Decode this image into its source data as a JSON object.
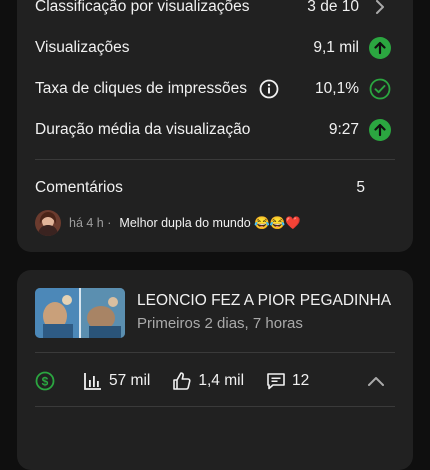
{
  "metrics_card": {
    "ranking": {
      "label": "Classificação por visualizações",
      "value": "3 de 10"
    },
    "views": {
      "label": "Visualizações",
      "value": "9,1 mil"
    },
    "ctr": {
      "label": "Taxa de cliques de impressões",
      "value": "10,1%"
    },
    "avg_duration": {
      "label": "Duração média da visualização",
      "value": "9:27"
    },
    "comments": {
      "label": "Comentários",
      "count": "5"
    },
    "latest_comment": {
      "time": "há 4 h",
      "separator": "·",
      "text": "Melhor dupla do mundo 😂😂❤️"
    }
  },
  "video_card": {
    "title": "LEONCIO FEZ A PIOR PEGADINHA ...",
    "subtitle": "Primeiros 2 dias, 7 horas",
    "stats": {
      "views": "57 mil",
      "likes": "1,4 mil",
      "comments": "12"
    }
  },
  "colors": {
    "background": "#0f0f0f",
    "card": "#212121",
    "positive_green": "#2ba640",
    "text_primary": "#f1f1f1",
    "text_secondary": "#aaaaaa"
  },
  "icons": [
    "chevron-right-icon",
    "arrow-up-circle-icon",
    "info-icon",
    "check-circle-icon",
    "monetization-icon",
    "bar-chart-icon",
    "thumbs-up-icon",
    "comment-icon",
    "chevron-up-icon"
  ]
}
